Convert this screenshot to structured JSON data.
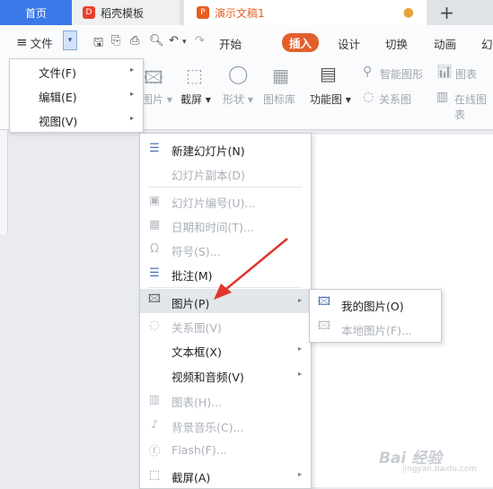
{
  "tabs": {
    "home": "首页",
    "template": "稻壳模板",
    "doc": "演示文稿1",
    "plus": "+"
  },
  "toolbar": {
    "menu_icon": "≡",
    "file_menu": "文件",
    "dropdown": "▾",
    "ribbon_tabs": [
      "开始",
      "插入",
      "设计",
      "切换",
      "动画",
      "幻"
    ]
  },
  "ribbon": {
    "picture": "图片",
    "screenshot": "截屏",
    "shape": "形状",
    "icon_lib": "图标库",
    "function_chart": "功能图",
    "smart_graphic": "智能图形",
    "chart": "图表",
    "relation": "关系图",
    "online_chart": "在线图表"
  },
  "file_menu": {
    "items": [
      {
        "label": "文件(F)",
        "arrow": "▸"
      },
      {
        "label": "编辑(E)",
        "arrow": "▸"
      },
      {
        "label": "视图(V)",
        "arrow": "▸"
      }
    ]
  },
  "insert_menu": {
    "items": [
      {
        "label": "新建幻灯片(N)"
      },
      {
        "label": "幻灯片副本(D)"
      },
      {
        "label": "幻灯片编号(U)..."
      },
      {
        "label": "日期和时间(T)..."
      },
      {
        "label": "符号(S)..."
      },
      {
        "label": "批注(M)"
      },
      {
        "label": "图片(P)",
        "arrow": "▸"
      },
      {
        "label": "关系图(V)"
      },
      {
        "label": "文本框(X)",
        "arrow": "▸"
      },
      {
        "label": "视频和音频(V)",
        "arrow": "▸"
      },
      {
        "label": "图表(H)..."
      },
      {
        "label": "背景音乐(C)..."
      },
      {
        "label": "Flash(F)..."
      },
      {
        "label": "截屏(A)",
        "arrow": "▸"
      }
    ]
  },
  "picture_menu": {
    "items": [
      {
        "label": "我的图片(O)"
      },
      {
        "label": "本地图片(F)..."
      }
    ]
  },
  "watermark": {
    "text": "Bai 经验",
    "sub": "jingyan.baidu.com"
  },
  "colors": {
    "accent_blue": "#3b78e7",
    "insert_tab": "#e25f2c",
    "arrow_red": "#e0352b",
    "highlight": "#e3e6ea"
  }
}
